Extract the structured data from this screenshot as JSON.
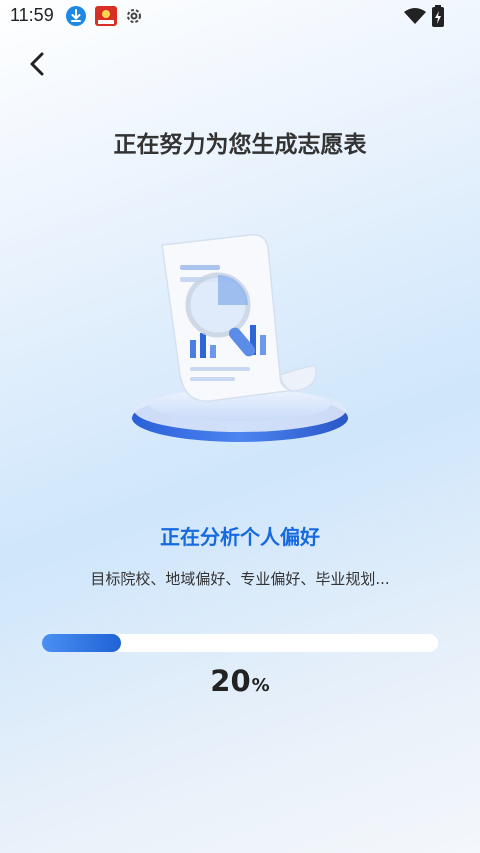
{
  "status_bar": {
    "time": "11:59"
  },
  "header": {
    "title": "正在努力为您生成志愿表"
  },
  "progress": {
    "status": "正在分析个人偏好",
    "detail": "目标院校、地域偏好、专业偏好、毕业规划...",
    "value": 20,
    "value_text": "20",
    "unit": "%"
  },
  "colors": {
    "accent": "#1769e0",
    "bar": "#3a7ee8"
  }
}
